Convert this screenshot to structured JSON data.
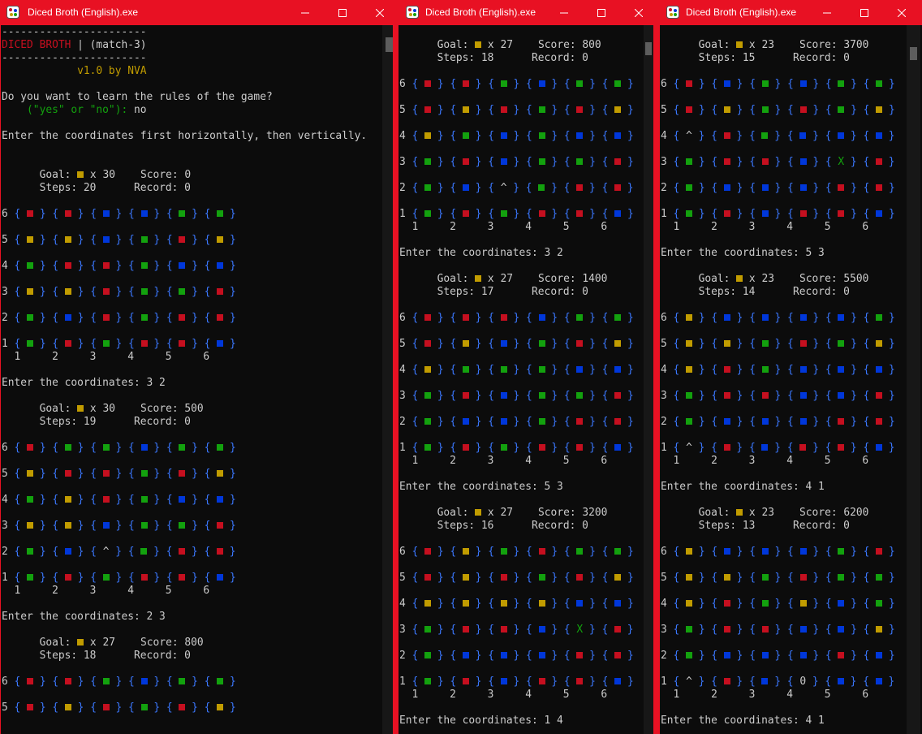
{
  "colors": {
    "red": "#c50f1f",
    "green": "#13a10e",
    "blue": "#0037da",
    "yellow": "#c19c00",
    "bracket": "#3b78ff",
    "titlebar": "#e81123",
    "console_bg": "#0c0c0c"
  },
  "windows": [
    {
      "title": "Diced Broth (English).exe",
      "lines": [
        {
          "t": "raw",
          "text": "-----------------------"
        },
        {
          "t": "header",
          "name": "DICED BROTH",
          "sep": " | ",
          "sub": "(match-3)"
        },
        {
          "t": "raw",
          "text": "-----------------------"
        },
        {
          "t": "version",
          "text": "            v1.0 by NVA"
        },
        {
          "t": "blank"
        },
        {
          "t": "raw",
          "text": "Do you want to learn the rules of the game?"
        },
        {
          "t": "prompt",
          "hint": "    (\"yes\" or \"no\"):",
          "answer": " no"
        },
        {
          "t": "blank"
        },
        {
          "t": "raw",
          "text": "Enter the coordinates first horizontally, then vertically."
        },
        {
          "t": "blank"
        },
        {
          "t": "blank"
        },
        {
          "t": "goal",
          "x": "30",
          "score": "0"
        },
        {
          "t": "steps",
          "steps": "20",
          "record": "0"
        },
        {
          "t": "blank"
        },
        {
          "t": "row",
          "n": "6",
          "cells": "RRBBGG"
        },
        {
          "t": "blank"
        },
        {
          "t": "row",
          "n": "5",
          "cells": "YYBGRY"
        },
        {
          "t": "blank"
        },
        {
          "t": "row",
          "n": "4",
          "cells": "GRRGBB"
        },
        {
          "t": "blank"
        },
        {
          "t": "row",
          "n": "3",
          "cells": "YYRGGR"
        },
        {
          "t": "blank"
        },
        {
          "t": "row",
          "n": "2",
          "cells": "GBRGRR"
        },
        {
          "t": "blank"
        },
        {
          "t": "row",
          "n": "1",
          "cells": "GRGRRB"
        },
        {
          "t": "axis"
        },
        {
          "t": "blank"
        },
        {
          "t": "raw",
          "text": "Enter the coordinates: 3 2"
        },
        {
          "t": "blank"
        },
        {
          "t": "goal",
          "x": "30",
          "score": "500"
        },
        {
          "t": "steps",
          "steps": "19",
          "record": "0"
        },
        {
          "t": "blank"
        },
        {
          "t": "row",
          "n": "6",
          "cells": "RGGBGG"
        },
        {
          "t": "blank"
        },
        {
          "t": "row",
          "n": "5",
          "cells": "YRRGRY"
        },
        {
          "t": "blank"
        },
        {
          "t": "row",
          "n": "4",
          "cells": "GYRGBB"
        },
        {
          "t": "blank"
        },
        {
          "t": "row",
          "n": "3",
          "cells": "YYBGGR"
        },
        {
          "t": "blank"
        },
        {
          "t": "row",
          "n": "2",
          "cells": "GB^GRR"
        },
        {
          "t": "blank"
        },
        {
          "t": "row",
          "n": "1",
          "cells": "GRGRRB"
        },
        {
          "t": "axis"
        },
        {
          "t": "blank"
        },
        {
          "t": "raw",
          "text": "Enter the coordinates: 2 3"
        },
        {
          "t": "blank"
        },
        {
          "t": "goal",
          "x": "27",
          "score": "800"
        },
        {
          "t": "steps",
          "steps": "18",
          "record": "0"
        },
        {
          "t": "blank"
        },
        {
          "t": "row",
          "n": "6",
          "cells": "RRGBGG"
        },
        {
          "t": "blank"
        },
        {
          "t": "row",
          "n": "5",
          "cells": "RYRGRY"
        }
      ]
    },
    {
      "title": "Diced Broth (English).exe",
      "lines": [
        {
          "t": "blank"
        },
        {
          "t": "goal",
          "x": "27",
          "score": "800"
        },
        {
          "t": "steps",
          "steps": "18",
          "record": "0"
        },
        {
          "t": "blank"
        },
        {
          "t": "row",
          "n": "6",
          "cells": "RRGBGG"
        },
        {
          "t": "blank"
        },
        {
          "t": "row",
          "n": "5",
          "cells": "RYRGRY"
        },
        {
          "t": "blank"
        },
        {
          "t": "row",
          "n": "4",
          "cells": "YGBGBB"
        },
        {
          "t": "blank"
        },
        {
          "t": "row",
          "n": "3",
          "cells": "GRBGGR"
        },
        {
          "t": "blank"
        },
        {
          "t": "row",
          "n": "2",
          "cells": "GB^GRR"
        },
        {
          "t": "blank"
        },
        {
          "t": "row",
          "n": "1",
          "cells": "GRGRRB"
        },
        {
          "t": "axis"
        },
        {
          "t": "blank"
        },
        {
          "t": "raw",
          "text": "Enter the coordinates: 3 2"
        },
        {
          "t": "blank"
        },
        {
          "t": "goal",
          "x": "27",
          "score": "1400"
        },
        {
          "t": "steps",
          "steps": "17",
          "record": "0"
        },
        {
          "t": "blank"
        },
        {
          "t": "row",
          "n": "6",
          "cells": "RRRBGG"
        },
        {
          "t": "blank"
        },
        {
          "t": "row",
          "n": "5",
          "cells": "RYBGRY"
        },
        {
          "t": "blank"
        },
        {
          "t": "row",
          "n": "4",
          "cells": "YGGGBB"
        },
        {
          "t": "blank"
        },
        {
          "t": "row",
          "n": "3",
          "cells": "GRBGGR"
        },
        {
          "t": "blank"
        },
        {
          "t": "row",
          "n": "2",
          "cells": "GBBGRR"
        },
        {
          "t": "blank"
        },
        {
          "t": "row",
          "n": "1",
          "cells": "GRGRRB"
        },
        {
          "t": "axis"
        },
        {
          "t": "blank"
        },
        {
          "t": "raw",
          "text": "Enter the coordinates: 5 3"
        },
        {
          "t": "blank"
        },
        {
          "t": "goal",
          "x": "27",
          "score": "3200"
        },
        {
          "t": "steps",
          "steps": "16",
          "record": "0"
        },
        {
          "t": "blank"
        },
        {
          "t": "row",
          "n": "6",
          "cells": "RYGRGG"
        },
        {
          "t": "blank"
        },
        {
          "t": "row",
          "n": "5",
          "cells": "RYRGRY"
        },
        {
          "t": "blank"
        },
        {
          "t": "row",
          "n": "4",
          "cells": "YYYYBB"
        },
        {
          "t": "blank"
        },
        {
          "t": "row",
          "n": "3",
          "cells": "GRRBXR"
        },
        {
          "t": "blank"
        },
        {
          "t": "row",
          "n": "2",
          "cells": "GBBBRR"
        },
        {
          "t": "blank"
        },
        {
          "t": "row",
          "n": "1",
          "cells": "GRBRRB"
        },
        {
          "t": "axis"
        },
        {
          "t": "blank"
        },
        {
          "t": "raw",
          "text": "Enter the coordinates: 1 4"
        }
      ]
    },
    {
      "title": "Diced Broth (English).exe",
      "lines": [
        {
          "t": "blank"
        },
        {
          "t": "goal",
          "x": "23",
          "score": "3700"
        },
        {
          "t": "steps",
          "steps": "15",
          "record": "0"
        },
        {
          "t": "blank"
        },
        {
          "t": "row",
          "n": "6",
          "cells": "RBGBGG"
        },
        {
          "t": "blank"
        },
        {
          "t": "row",
          "n": "5",
          "cells": "RYGRGY"
        },
        {
          "t": "blank"
        },
        {
          "t": "row",
          "n": "4",
          "cells": "^RGBBB"
        },
        {
          "t": "blank"
        },
        {
          "t": "row",
          "n": "3",
          "cells": "GRRBXR"
        },
        {
          "t": "blank"
        },
        {
          "t": "row",
          "n": "2",
          "cells": "GBBBRR"
        },
        {
          "t": "blank"
        },
        {
          "t": "row",
          "n": "1",
          "cells": "GRBRRB"
        },
        {
          "t": "axis"
        },
        {
          "t": "blank"
        },
        {
          "t": "raw",
          "text": "Enter the coordinates: 5 3"
        },
        {
          "t": "blank"
        },
        {
          "t": "goal",
          "x": "23",
          "score": "5500"
        },
        {
          "t": "steps",
          "steps": "14",
          "record": "0"
        },
        {
          "t": "blank"
        },
        {
          "t": "row",
          "n": "6",
          "cells": "YBBBBG"
        },
        {
          "t": "blank"
        },
        {
          "t": "row",
          "n": "5",
          "cells": "YYGRGY"
        },
        {
          "t": "blank"
        },
        {
          "t": "row",
          "n": "4",
          "cells": "YRGBBB"
        },
        {
          "t": "blank"
        },
        {
          "t": "row",
          "n": "3",
          "cells": "GRRBBR"
        },
        {
          "t": "blank"
        },
        {
          "t": "row",
          "n": "2",
          "cells": "GBBBRR"
        },
        {
          "t": "blank"
        },
        {
          "t": "row",
          "n": "1",
          "cells": "^RBRRB"
        },
        {
          "t": "axis"
        },
        {
          "t": "blank"
        },
        {
          "t": "raw",
          "text": "Enter the coordinates: 4 1"
        },
        {
          "t": "blank"
        },
        {
          "t": "goal",
          "x": "23",
          "score": "6200"
        },
        {
          "t": "steps",
          "steps": "13",
          "record": "0"
        },
        {
          "t": "blank"
        },
        {
          "t": "row",
          "n": "6",
          "cells": "YBBBGR"
        },
        {
          "t": "blank"
        },
        {
          "t": "row",
          "n": "5",
          "cells": "YYGRGG"
        },
        {
          "t": "blank"
        },
        {
          "t": "row",
          "n": "4",
          "cells": "YRGYBG"
        },
        {
          "t": "blank"
        },
        {
          "t": "row",
          "n": "3",
          "cells": "GRRBBY"
        },
        {
          "t": "blank"
        },
        {
          "t": "row",
          "n": "2",
          "cells": "GBBBRB"
        },
        {
          "t": "blank"
        },
        {
          "t": "row",
          "n": "1",
          "cells": "^RB0BB"
        },
        {
          "t": "axis"
        },
        {
          "t": "blank"
        },
        {
          "t": "raw",
          "text": "Enter the coordinates: 4 1"
        }
      ]
    }
  ],
  "labels": {
    "goal": "Goal:",
    "x": "x",
    "score": "Score:",
    "steps": "Steps:",
    "record": "Record:",
    "axis": "  1     2     3     4     5     6"
  },
  "icons": {
    "minimize": "minimize-icon",
    "maximize": "maximize-icon",
    "close": "close-icon",
    "app": "dice-app-icon"
  }
}
